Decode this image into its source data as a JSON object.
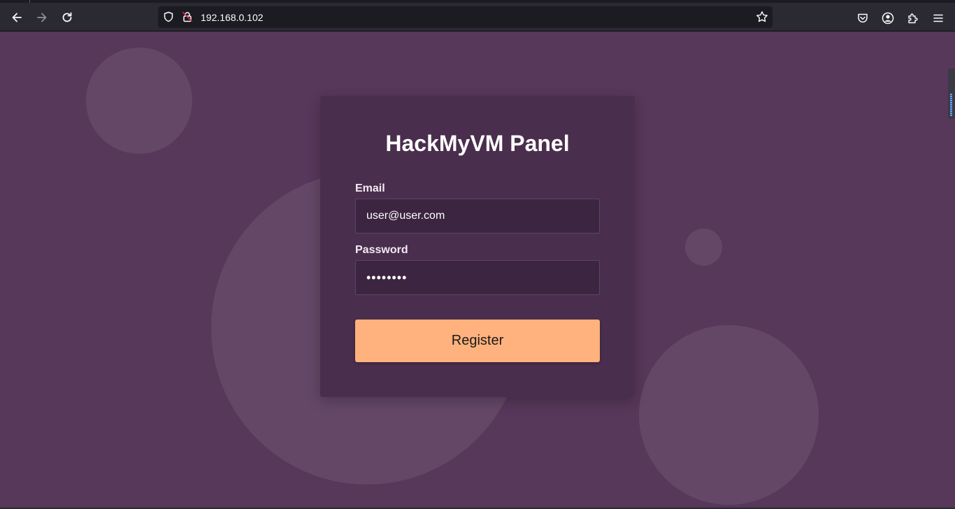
{
  "browser": {
    "url": "192.168.0.102",
    "icons": {
      "back": "arrow-left-icon",
      "forward": "arrow-right-icon",
      "reload": "reload-icon",
      "shield": "tracking-protection-shield-icon",
      "lock": "insecure-lock-icon",
      "bookmark": "star-icon",
      "pocket": "pocket-icon",
      "account": "account-icon",
      "extensions": "extensions-puzzle-icon",
      "menu": "hamburger-menu-icon"
    },
    "colors": {
      "toolbar": "#2b2a33",
      "urlbar": "#1c1b22"
    }
  },
  "panel": {
    "title": "HackMyVM Panel",
    "email_label": "Email",
    "email_value": "user@user.com",
    "password_label": "Password",
    "password_value": "password",
    "register_label": "Register"
  },
  "colors": {
    "page_background": "#57375a",
    "card_background": "#4a2e4d",
    "input_background": "#3c2540",
    "button_background": "#ffb27d"
  }
}
